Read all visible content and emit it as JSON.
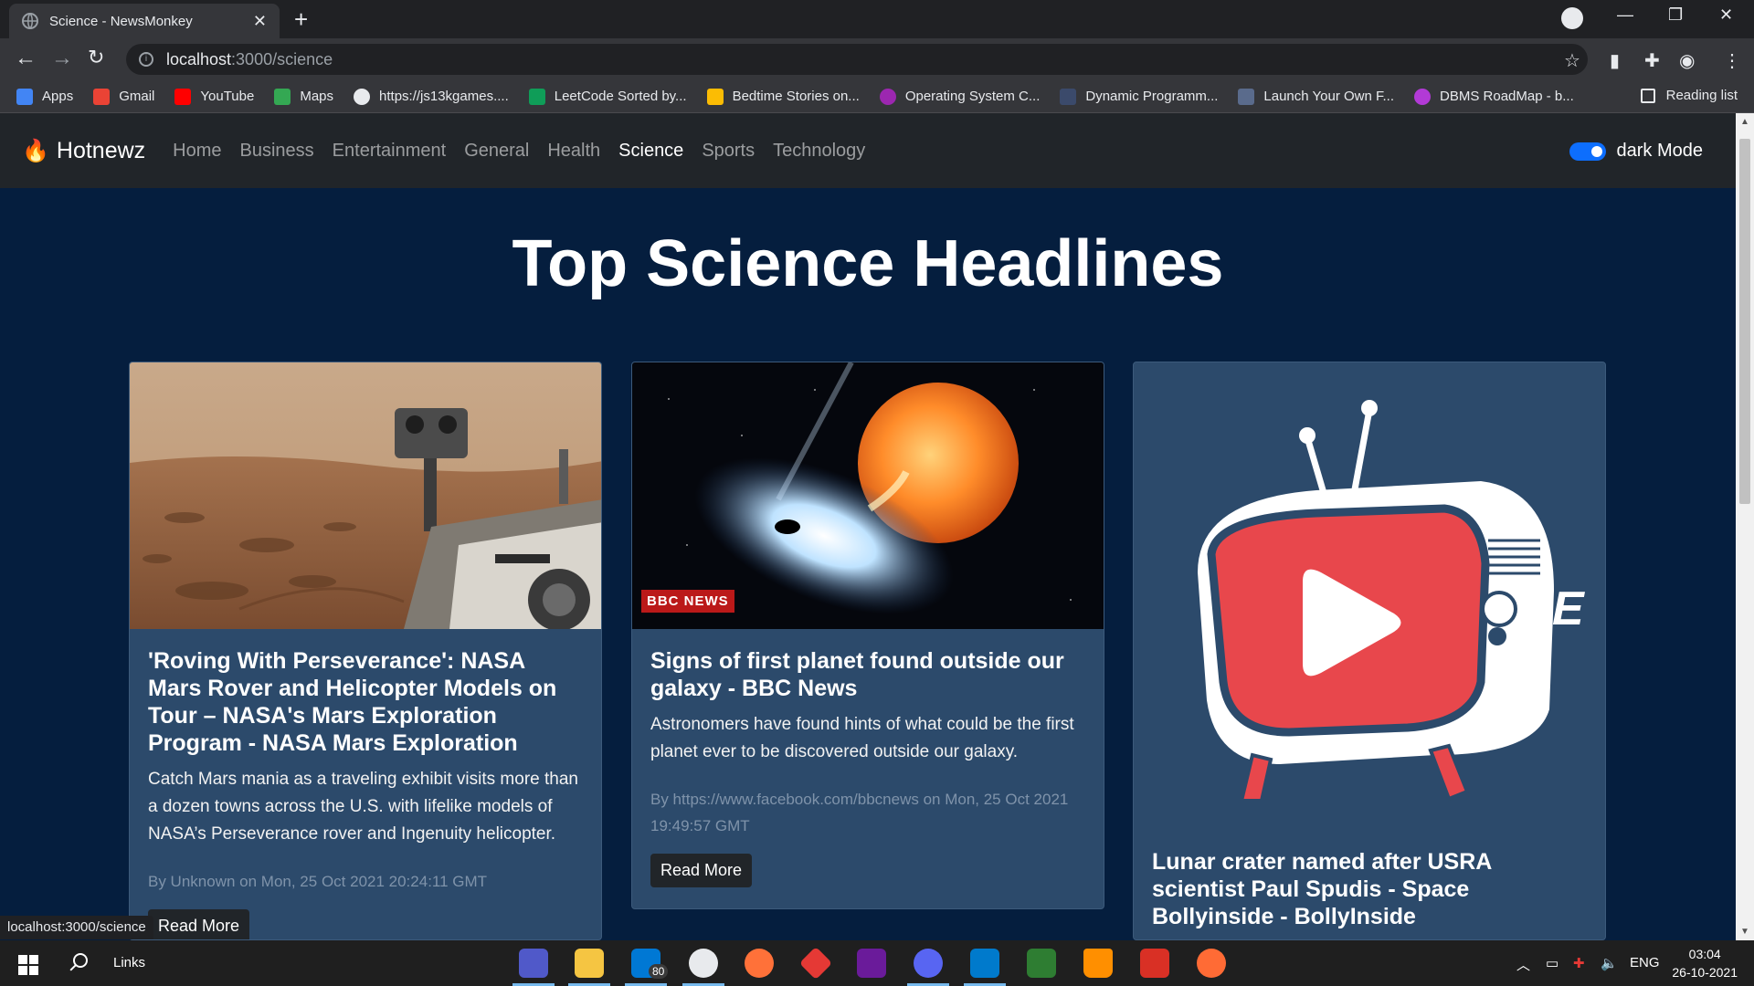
{
  "browser": {
    "tab_title": "Science - NewsMonkey",
    "url_host": "localhost",
    "url_path": ":3000/science",
    "bookmarks": [
      {
        "label": "Apps",
        "color": "#4285f4"
      },
      {
        "label": "Gmail",
        "color": "#ea4335"
      },
      {
        "label": "YouTube",
        "color": "#ff0000"
      },
      {
        "label": "Maps",
        "color": "#34a853"
      },
      {
        "label": "https://js13kgames....",
        "color": "#e8eaed"
      },
      {
        "label": "LeetCode Sorted by...",
        "color": "#0f9d58"
      },
      {
        "label": "Bedtime Stories on...",
        "color": "#fbbc04"
      },
      {
        "label": "Operating System C...",
        "color": "#9c27b0"
      },
      {
        "label": "Dynamic Programm...",
        "color": "#3b4a6b"
      },
      {
        "label": "Launch Your Own F...",
        "color": "#5a6b8c"
      },
      {
        "label": "DBMS RoadMap - b...",
        "color": "#b23ad6"
      }
    ],
    "reading_list": "Reading list",
    "status_url": "localhost:3000/science"
  },
  "site": {
    "brand": "Hotnewz",
    "nav": [
      "Home",
      "Business",
      "Entertainment",
      "General",
      "Health",
      "Science",
      "Sports",
      "Technology"
    ],
    "active": "Science",
    "dark_mode_label": "dark Mode",
    "heading": "Top Science Headlines"
  },
  "articles": [
    {
      "title": "'Roving With Perseverance': NASA Mars Rover and Helicopter Models on Tour – NASA's Mars Exploration Program - NASA Mars Exploration",
      "description": "Catch Mars mania as a traveling exhibit visits more than a dozen towns across the U.S. with lifelike models of NASA’s Perseverance rover and Ingenuity helicopter.",
      "meta": "By Unknown on Mon, 25 Oct 2021 20:24:11 GMT",
      "button": "Read More"
    },
    {
      "title": "Signs of first planet found outside our galaxy - BBC News",
      "description": "Astronomers have found hints of what could be the first planet ever to be discovered outside our galaxy.",
      "meta": "By https://www.facebook.com/bbcnews on Mon, 25 Oct 2021 19:49:57 GMT",
      "button": "Read More",
      "badge": "BBC NEWS"
    },
    {
      "title": "Lunar crater named after USRA scientist Paul Spudis - Space Bollyinside - BollyInside",
      "logo_letter": "E"
    }
  ],
  "taskbar": {
    "search_label": "Links",
    "mail_badge": "80",
    "lang": "ENG",
    "time": "03:04",
    "date": "26-10-2021"
  }
}
